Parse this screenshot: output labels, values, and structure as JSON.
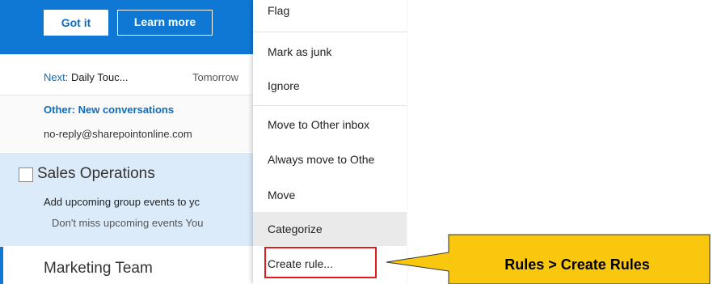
{
  "banner": {
    "got_it_label": "Got it",
    "learn_more_label": "Learn more"
  },
  "list": {
    "next": {
      "prefix": "Next:",
      "title": "Daily Touc...",
      "when": "Tomorrow"
    },
    "other": {
      "title": "Other: New conversations",
      "sender": "no-reply@sharepointonline.com"
    },
    "sales": {
      "name": "Sales Operations",
      "subject": "Add upcoming group events to yc",
      "preview": "Don't miss upcoming events You"
    },
    "marketing": {
      "name": "Marketing Team"
    }
  },
  "menu": {
    "items": [
      {
        "label": "Flag"
      },
      {
        "label": "Mark as junk"
      },
      {
        "label": "Ignore"
      },
      {
        "label": "Move to Other inbox"
      },
      {
        "label": "Always move to Othe"
      },
      {
        "label": "Move"
      },
      {
        "label": "Categorize"
      },
      {
        "label": "Create rule..."
      }
    ]
  },
  "callout": {
    "text": "Rules > Create Rules"
  },
  "colors": {
    "accent": "#0f78d4",
    "highlight": "#e21b1b",
    "callout": "#f9c80e"
  }
}
